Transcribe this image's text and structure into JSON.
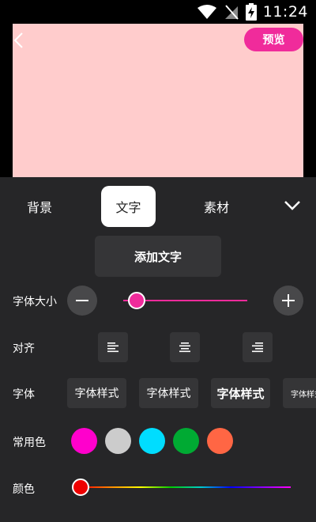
{
  "status_bar": {
    "time": "11:24"
  },
  "preview": {
    "label": "预览"
  },
  "tabs": [
    {
      "label": "背景",
      "active": false
    },
    {
      "label": "文字",
      "active": true
    },
    {
      "label": "素材",
      "active": false
    }
  ],
  "add_text_label": "添加文字",
  "font_size": {
    "label": "字体大小",
    "value_fraction": 0.11
  },
  "align": {
    "label": "对齐",
    "options": [
      "left",
      "center",
      "right"
    ]
  },
  "font": {
    "label": "字体",
    "styles": [
      "字体样式",
      "字体样式",
      "字体样式",
      "字体样式"
    ]
  },
  "common_colors": {
    "label": "常用色",
    "colors": [
      "#ff00cc",
      "#cccccc",
      "#00ddff",
      "#00aa33",
      "#ff6644"
    ]
  },
  "color": {
    "label": "颜色",
    "value_fraction": 0.0,
    "selected": "#ee0000"
  },
  "accent_color": "#f02b9b"
}
